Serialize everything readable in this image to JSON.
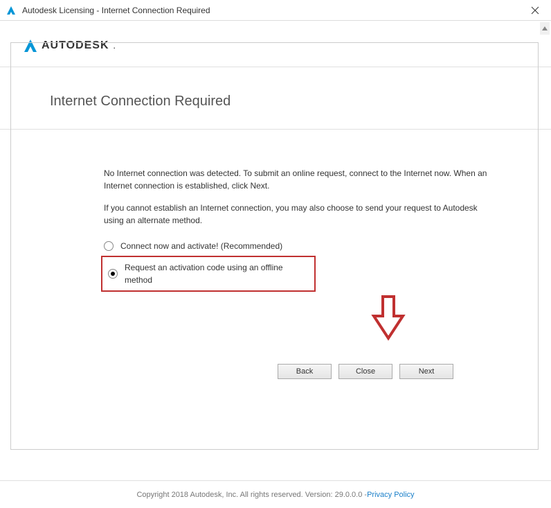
{
  "titlebar": {
    "title": "Autodesk Licensing - Internet Connection Required"
  },
  "logo": {
    "text": "AUTODESK"
  },
  "heading": "Internet Connection Required",
  "body": {
    "para1": "No Internet connection was detected. To submit an online request, connect to the Internet now. When an Internet connection is established, click Next.",
    "para2": "If you cannot establish an Internet connection, you may also choose to send your request to Autodesk using an alternate method."
  },
  "options": {
    "opt1": "Connect now and activate! (Recommended)",
    "opt2": "Request an activation code using an offline method"
  },
  "buttons": {
    "back": "Back",
    "close": "Close",
    "next": "Next"
  },
  "footer": {
    "copyright": "Copyright 2018 Autodesk, Inc. All rights reserved. Version: 29.0.0.0 - ",
    "privacy": "Privacy Policy"
  },
  "annotation": {
    "arrow_color": "#c03030",
    "highlight_color": "#c03030"
  }
}
